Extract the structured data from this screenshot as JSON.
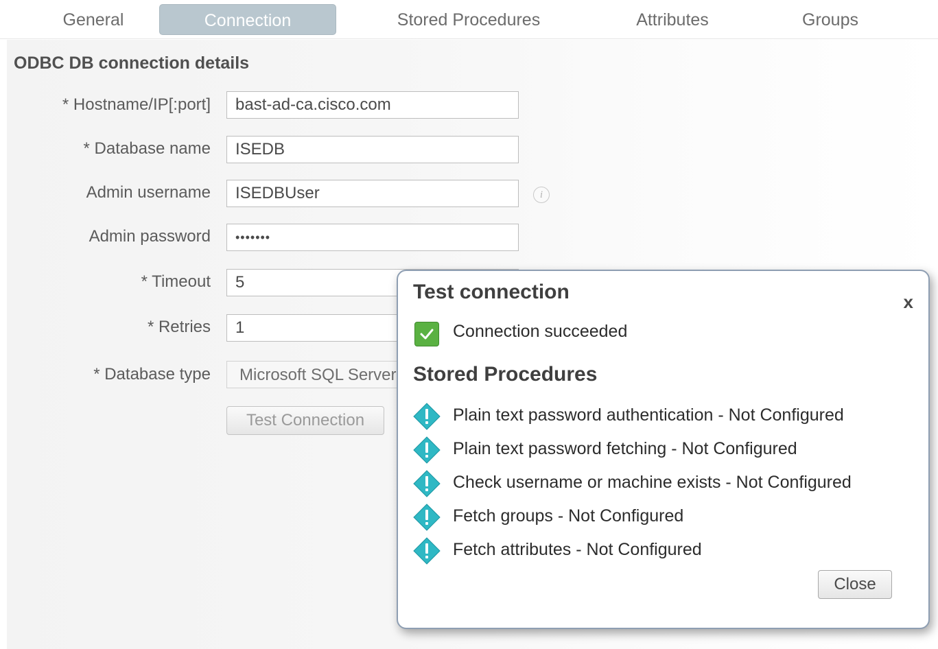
{
  "tabs": [
    {
      "label": "General"
    },
    {
      "label": "Connection"
    },
    {
      "label": "Stored Procedures"
    },
    {
      "label": "Attributes"
    },
    {
      "label": "Groups"
    }
  ],
  "active_tab": "Connection",
  "form": {
    "section_title": "ODBC DB connection details",
    "hostname": {
      "label": "* Hostname/IP[:port]",
      "value": "bast-ad-ca.cisco.com"
    },
    "database_name": {
      "label": "* Database name",
      "value": "ISEDB"
    },
    "admin_username": {
      "label": "Admin username",
      "value": "ISEDBUser"
    },
    "admin_password": {
      "label": "Admin password",
      "value": "•••••••"
    },
    "timeout": {
      "label": "* Timeout",
      "value": "5"
    },
    "retries": {
      "label": "* Retries",
      "value": "1"
    },
    "database_type": {
      "label": "* Database type",
      "value": "Microsoft SQL Server"
    },
    "test_connection_label": "Test Connection",
    "info_icon": "info-icon"
  },
  "dialog": {
    "title": "Test connection",
    "close_x": "x",
    "status_text": "Connection succeeded",
    "status_icon": "checkmark-icon",
    "stored_procedures_title": "Stored Procedures",
    "items": [
      {
        "text": "Plain text password authentication - Not Configured",
        "icon": "warning-icon"
      },
      {
        "text": "Plain text password fetching - Not Configured",
        "icon": "warning-icon"
      },
      {
        "text": "Check username or machine exists - Not Configured",
        "icon": "warning-icon"
      },
      {
        "text": "Fetch groups - Not Configured",
        "icon": "warning-icon"
      },
      {
        "text": "Fetch attributes - Not Configured",
        "icon": "warning-icon"
      }
    ],
    "close_label": "Close"
  },
  "colors": {
    "active_tab": "#b9c7cf",
    "success": "#5ab142",
    "warning_icon": "#2fb8c4"
  }
}
